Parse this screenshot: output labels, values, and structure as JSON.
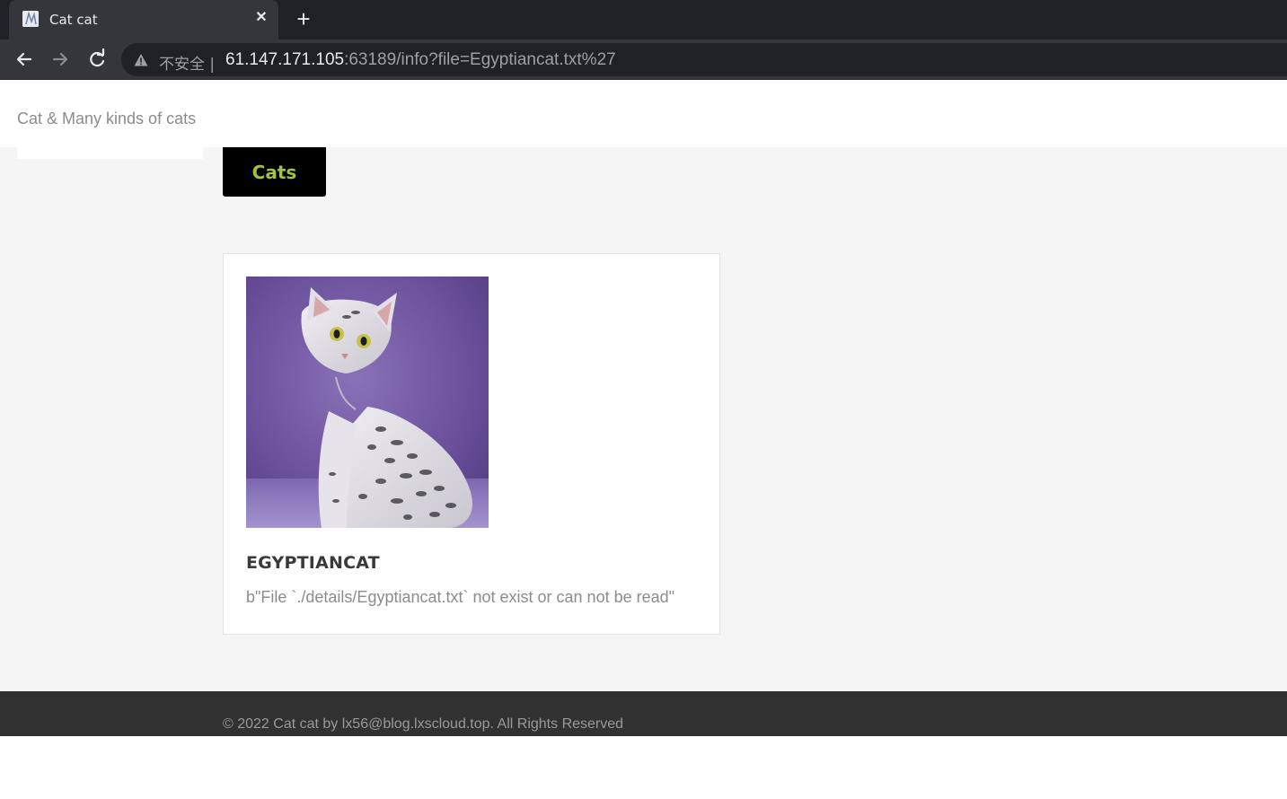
{
  "browser": {
    "tab_title": "Cat cat",
    "close_glyph": "✕",
    "new_tab_glyph": "+",
    "security_label": "不安全 |",
    "url_host": "61.147.171.105",
    "url_rest": ":63189/info?file=Egyptiancat.txt%27"
  },
  "header": {
    "brand": "Cat & Many kinds of cats",
    "nav_button": "Cats"
  },
  "card": {
    "title": "EGYPTIANCAT",
    "text": "b\"File `./details/Egyptiancat.txt` not exist or can not be read\""
  },
  "footer": {
    "text": "© 2022 Cat cat by lx56@blog.lxscloud.top. All Rights Reserved"
  },
  "colors": {
    "accent": "#a3c144",
    "chrome_dark": "#202124",
    "chrome_mid": "#35363a",
    "footer_bg": "#313131"
  }
}
